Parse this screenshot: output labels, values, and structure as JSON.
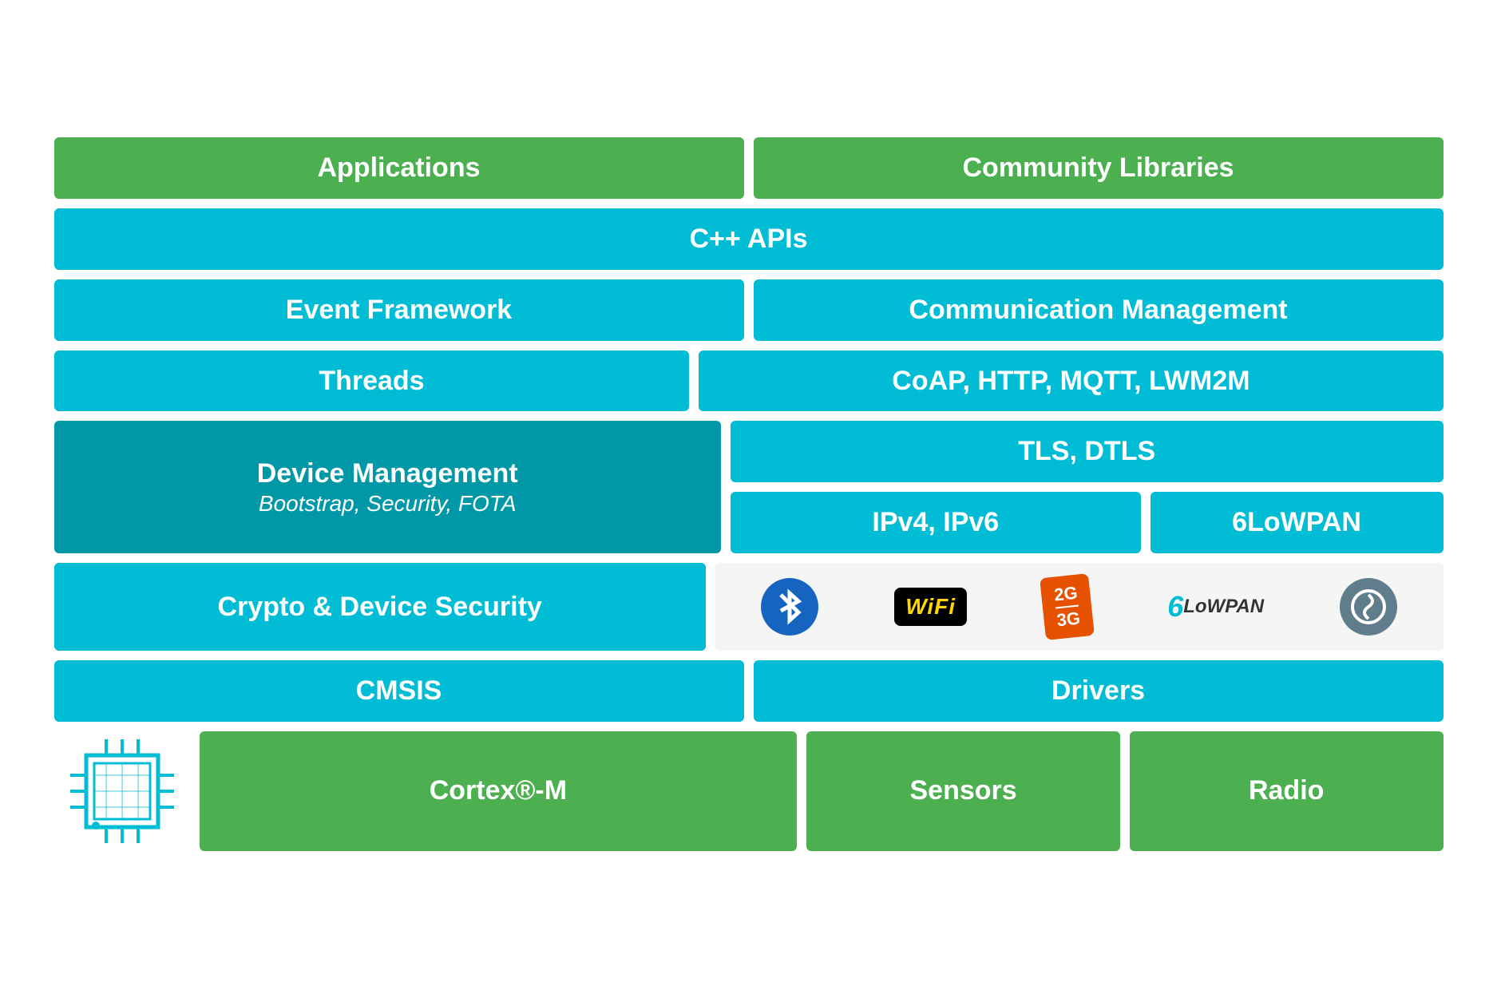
{
  "header": {
    "applications_label": "Applications",
    "community_libraries_label": "Community Libraries"
  },
  "row_cpp": {
    "label": "C++ APIs"
  },
  "row_event_comm": {
    "event_framework_label": "Event Framework",
    "comm_management_label": "Communication Management"
  },
  "row_threads_coap": {
    "threads_label": "Threads",
    "coap_label": "CoAP, HTTP, MQTT, LWM2M"
  },
  "row_devmgmt_tls": {
    "device_management_label": "Device Management",
    "device_management_sub": "Bootstrap, Security, FOTA",
    "tls_label": "TLS, DTLS"
  },
  "row_ipv_6lo": {
    "ipv_label": "IPv4, IPv6",
    "lowpan_label": "6LoWPAN"
  },
  "row_crypto_logos": {
    "crypto_label": "Crypto & Device Security"
  },
  "row_cmsis_drivers": {
    "cmsis_label": "CMSIS",
    "drivers_label": "Drivers"
  },
  "row_cortex_sensors_radio": {
    "cortex_label": "Cortex®-M",
    "sensors_label": "Sensors",
    "radio_label": "Radio"
  },
  "logos": {
    "wifi_label": "WiFi",
    "g_line1": "2G",
    "g_line2": "3G",
    "lowpan_6_label": "6",
    "lowpan_rest_label": "LoWPAN"
  }
}
